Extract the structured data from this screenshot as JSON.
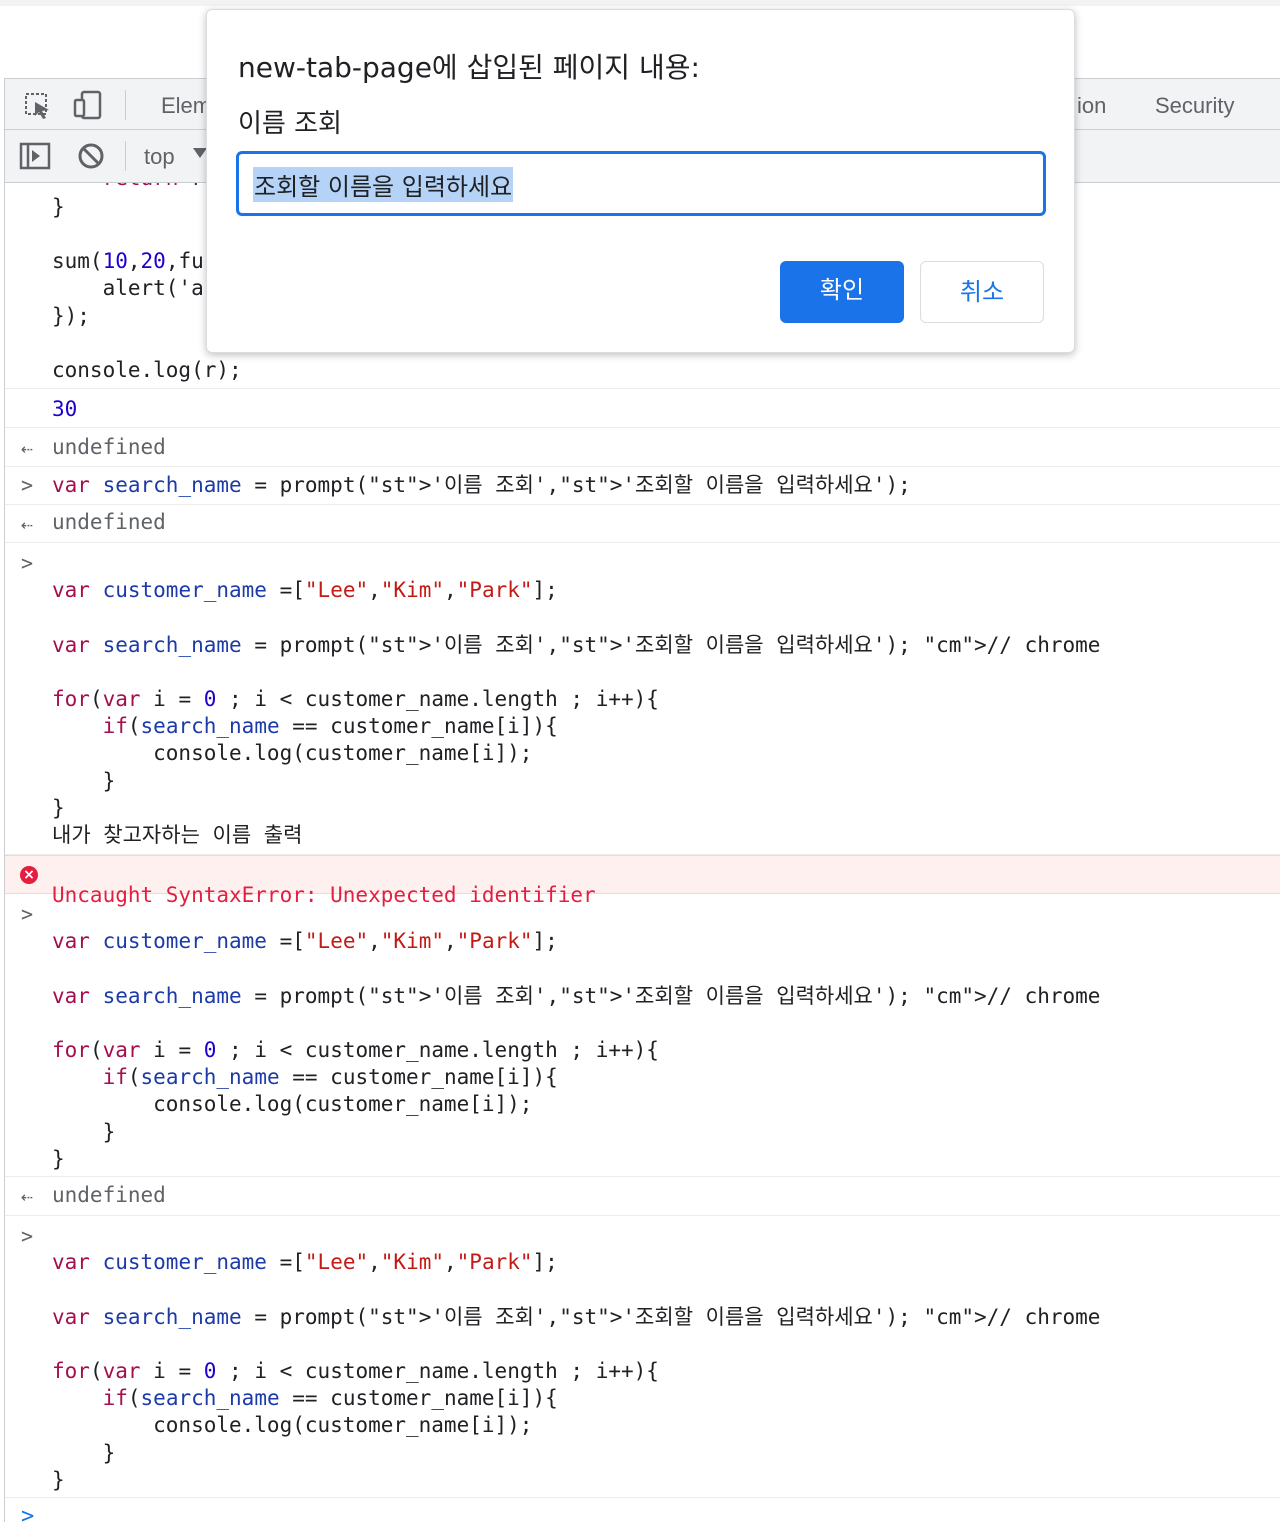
{
  "devtools": {
    "tabs": {
      "elements": "Elem",
      "application": "ion",
      "security": "Security"
    },
    "context": "top"
  },
  "dialog": {
    "title": "new-tab-page에 삽입된 페이지 내용:",
    "message": "이름 조회",
    "input_value": "조회할 이름을 입력하세요",
    "ok_label": "확인",
    "cancel_label": "취소"
  },
  "console": {
    "fragment_top": "    return r",
    "close_brace": "}",
    "sum_call_1": "sum(10,20,fu",
    "sum_call_2": "    alert('a",
    "sum_call_3": "});",
    "console_log_r": "console.log(r);",
    "output_30": "30",
    "undefined": "undefined",
    "prompt_line": "var search_name = prompt('이름 조회','조회할 이름을 입력하세요');",
    "block_line_1": "var customer_name =[\"Lee\",\"Kim\",\"Park\"];",
    "block_line_2": "var search_name = prompt('이름 조회','조회할 이름을 입력하세요'); // chrome",
    "block_line_3": "for(var i = 0 ; i < customer_name.length ; i++){",
    "block_line_4": "    if(search_name == customer_name[i]){",
    "block_line_5": "        console.log(customer_name[i]);",
    "block_line_6": "    }",
    "block_line_7": "}",
    "korean_line": "내가 찾고자하는 이름 출력",
    "error_text": "Uncaught SyntaxError: Unexpected identifier"
  }
}
